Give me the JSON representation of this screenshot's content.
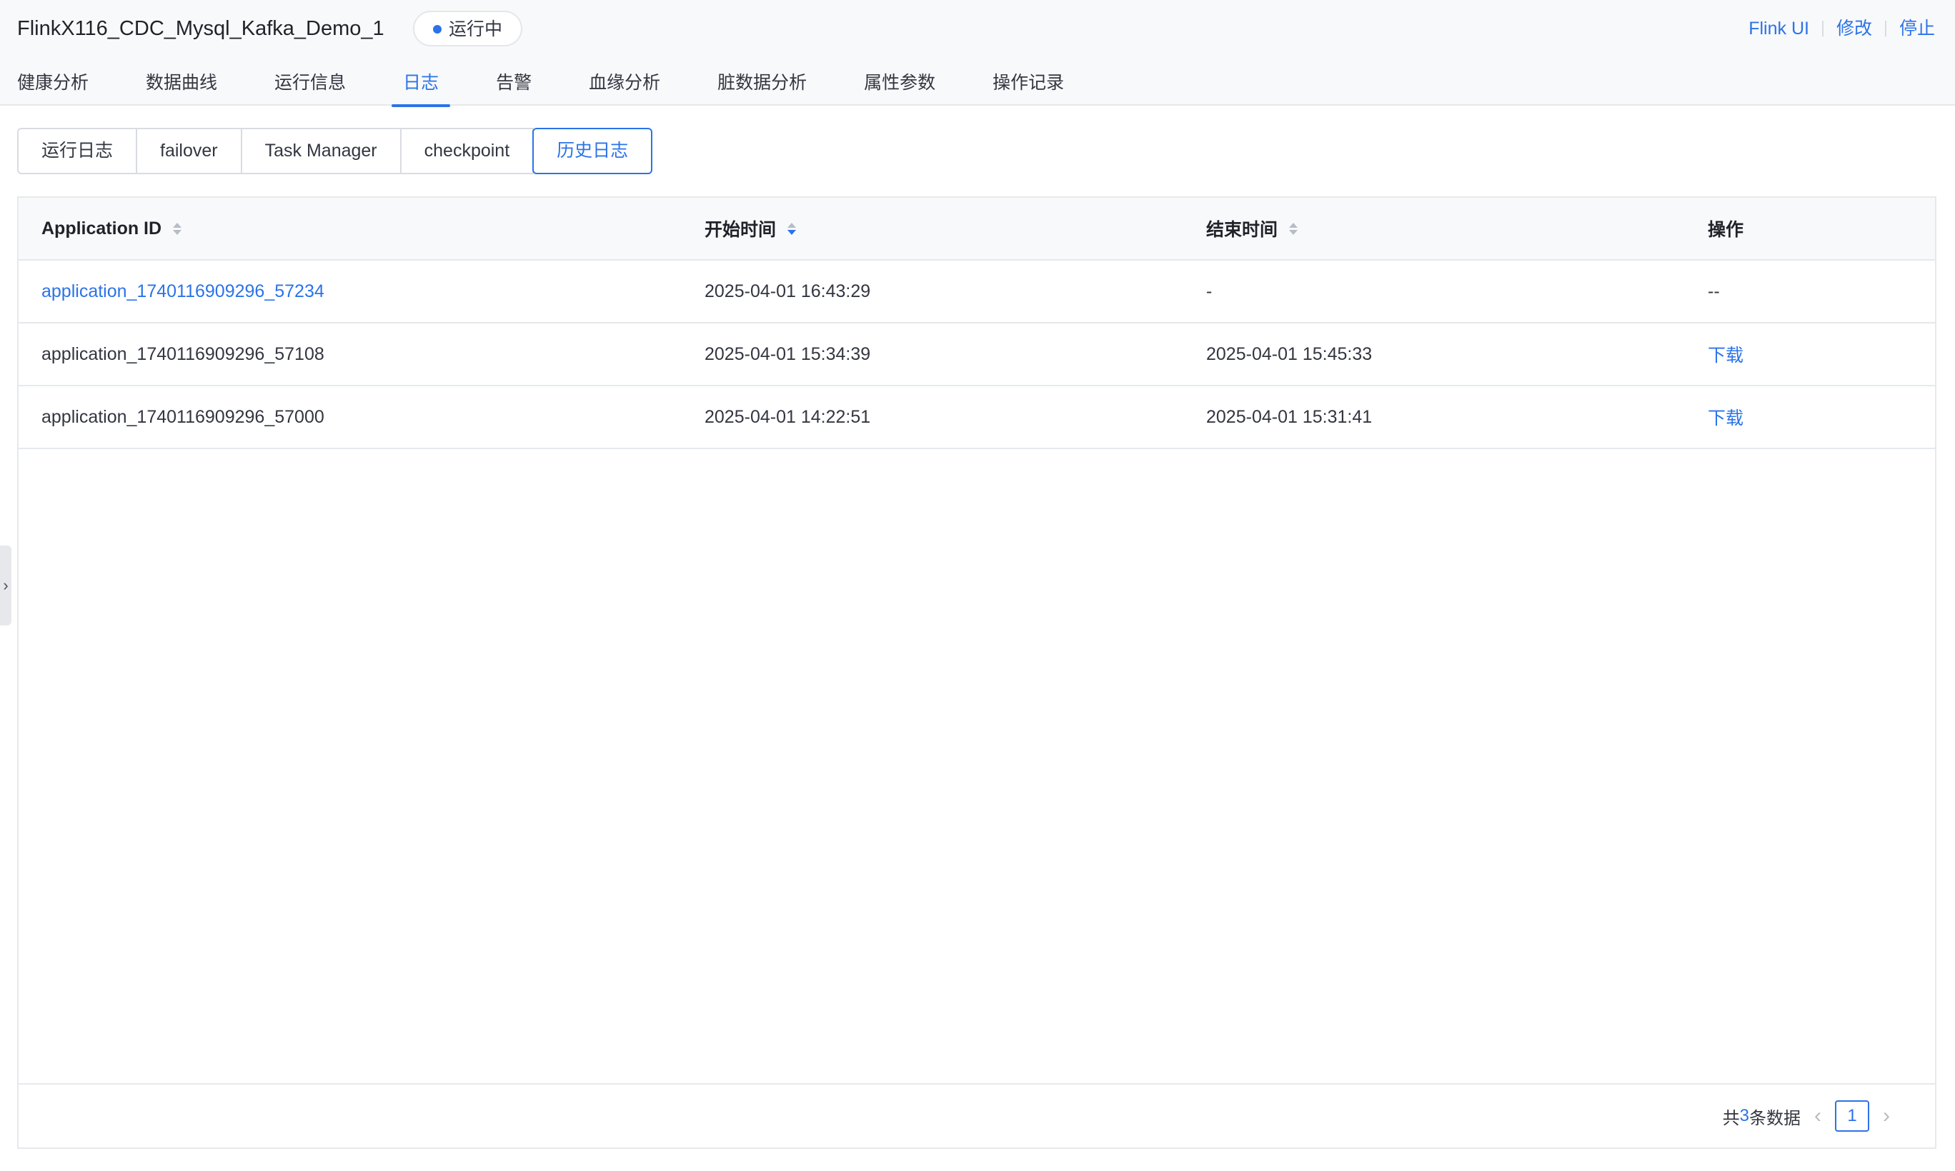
{
  "header": {
    "job_name": "FlinkX116_CDC_Mysql_Kafka_Demo_1",
    "status": "运行中",
    "actions": {
      "flink_ui": "Flink UI",
      "edit": "修改",
      "stop": "停止"
    }
  },
  "tabs": [
    {
      "label": "健康分析"
    },
    {
      "label": "数据曲线"
    },
    {
      "label": "运行信息"
    },
    {
      "label": "日志",
      "active": true
    },
    {
      "label": "告警"
    },
    {
      "label": "血缘分析"
    },
    {
      "label": "脏数据分析"
    },
    {
      "label": "属性参数"
    },
    {
      "label": "操作记录"
    }
  ],
  "subtabs": [
    {
      "label": "运行日志"
    },
    {
      "label": "failover"
    },
    {
      "label": "Task Manager"
    },
    {
      "label": "checkpoint"
    },
    {
      "label": "历史日志",
      "active": true
    }
  ],
  "table": {
    "columns": {
      "app_id": "Application ID",
      "start_time": "开始时间",
      "end_time": "结束时间",
      "action": "操作"
    },
    "sort": {
      "start_time": "desc"
    },
    "rows": [
      {
        "app_id": "application_1740116909296_57234",
        "start_time": "2025-04-01 16:43:29",
        "end_time": "-",
        "action": "--"
      },
      {
        "app_id": "application_1740116909296_57108",
        "start_time": "2025-04-01 15:34:39",
        "end_time": "2025-04-01 15:45:33",
        "action": "下载"
      },
      {
        "app_id": "application_1740116909296_57000",
        "start_time": "2025-04-01 14:22:51",
        "end_time": "2025-04-01 15:31:41",
        "action": "下载"
      }
    ]
  },
  "pagination": {
    "total_prefix": "共",
    "total": "3",
    "total_suffix": "条数据",
    "current_page": "1"
  },
  "colors": {
    "accent": "#2b73e8",
    "border": "#e6e8ec",
    "header_bg": "#f8f9fb"
  }
}
